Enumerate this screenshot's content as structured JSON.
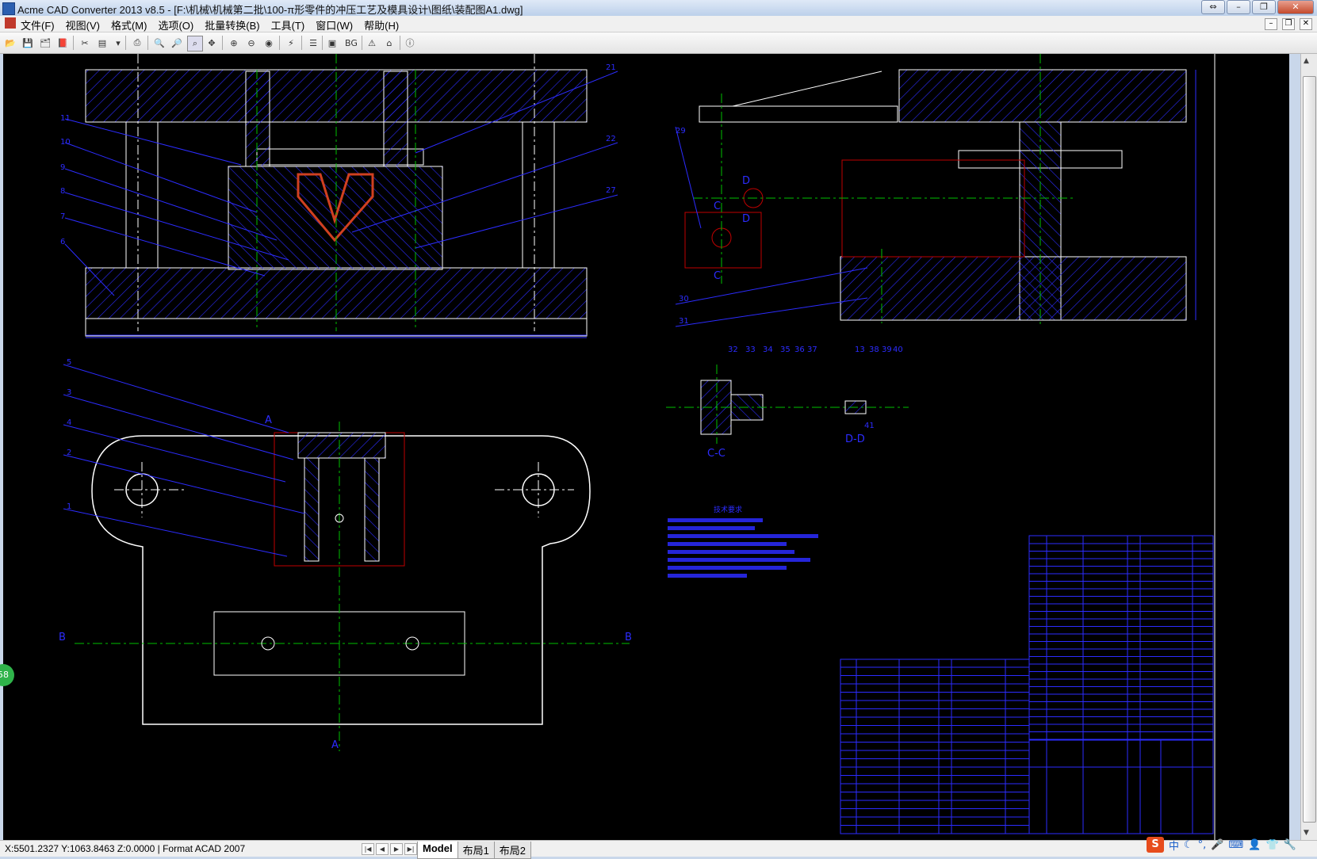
{
  "window": {
    "title": "Acme CAD Converter 2013 v8.5 - [F:\\机械\\机械第二批\\100-π形零件的冲压工艺及模具设计\\图纸\\装配图A1.dwg]"
  },
  "menu": [
    "文件(F)",
    "视图(V)",
    "格式(M)",
    "选项(O)",
    "批量转换(B)",
    "工具(T)",
    "窗口(W)",
    "帮助(H)"
  ],
  "toolbar": {
    "bg_label": "BG"
  },
  "status": {
    "coords": "X:5501.2327 Y:1063.8463 Z:0.0000 | Format ACAD 2007"
  },
  "tabs": [
    {
      "label": "Model",
      "active": true
    },
    {
      "label": "布局1"
    },
    {
      "label": "布局2"
    }
  ],
  "badge": "58",
  "tray": {
    "ime_icon": "S",
    "lang": "中"
  },
  "drawing": {
    "bom_left": [
      "1",
      "2",
      "3",
      "4",
      "5",
      "6",
      "7",
      "8",
      "9",
      "10",
      "11"
    ],
    "bom_right": [
      "21",
      "22",
      "27",
      "28"
    ],
    "sec_label_a": "A",
    "sec_label_b": "B",
    "sec_label_c": "C",
    "sec_label_d": "D",
    "view_cc": "C-C",
    "view_dd": "D-D",
    "nums_mid": [
      "32",
      "33",
      "34",
      "35",
      "36",
      "37"
    ],
    "nums_mid2": [
      "13",
      "38",
      "39",
      "40",
      "41"
    ],
    "nums_side": [
      "29",
      "30",
      "31"
    ],
    "tech_title": "技术要求"
  },
  "colors": {
    "canvas": "#000000",
    "line_white": "#ffffff",
    "line_blue": "#2c2cff",
    "line_green": "#00c000",
    "line_red": "#c00000"
  }
}
